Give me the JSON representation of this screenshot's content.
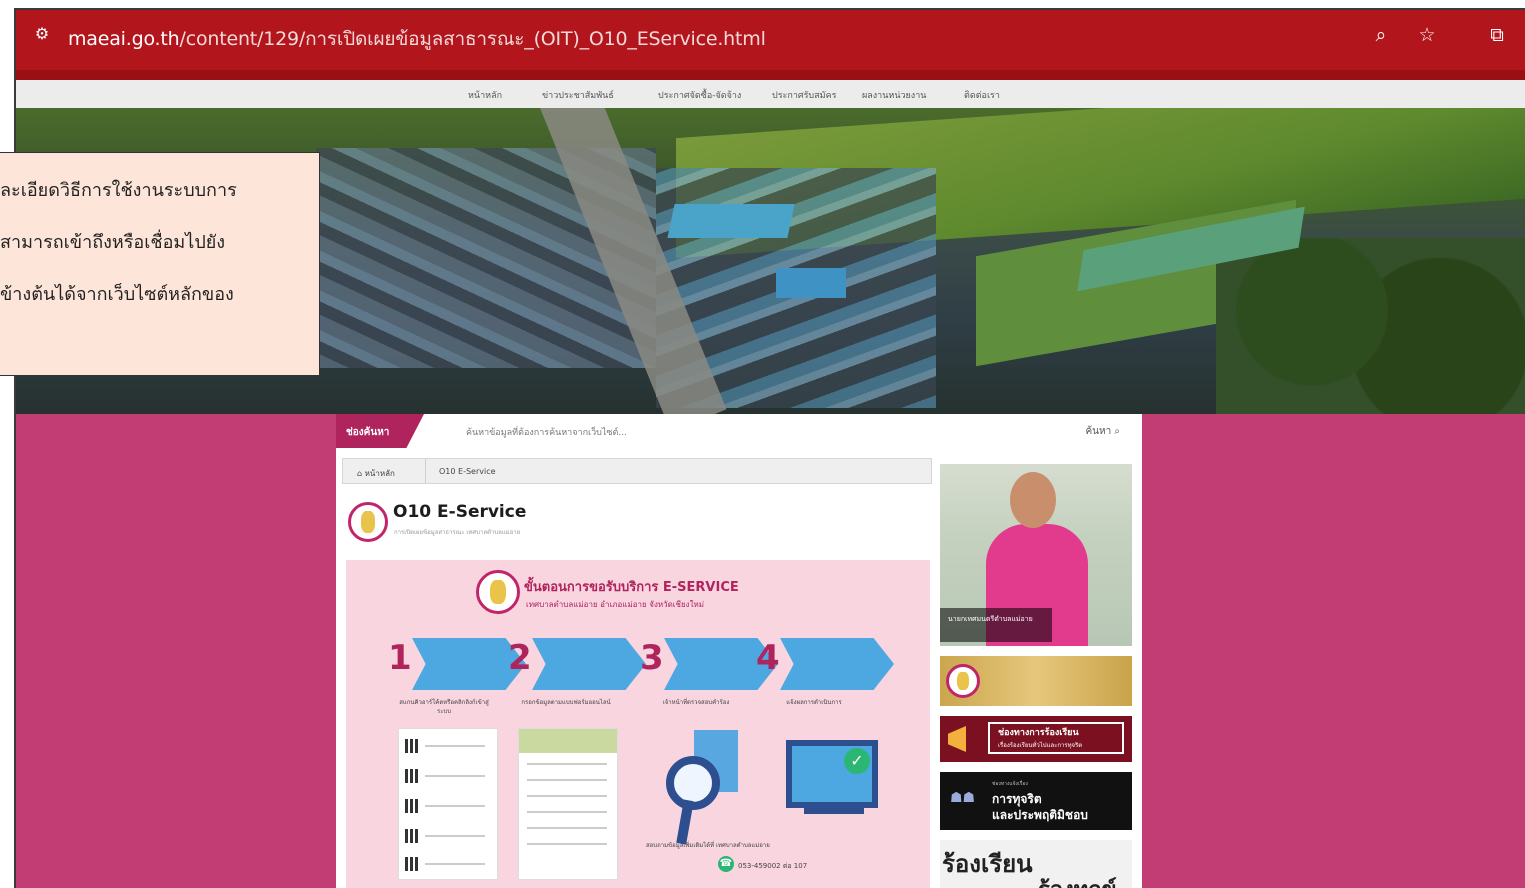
{
  "browser": {
    "url_host": "maeai.go.th",
    "url_path": "/content/129/การเปิดเผยข้อมูลสาธารณะ_(OIT)_O10_EService.html",
    "icons": [
      "site-settings-icon",
      "zoom-icon",
      "star-icon",
      "extensions-icon"
    ]
  },
  "nav": {
    "items": [
      "หน้าหลัก",
      "ข่าวประชาสัมพันธ์",
      "ประกาศจัดซื้อ-จัดจ้าง",
      "ประกาศรับสมัคร",
      "ผลงานหน่วยงาน",
      "ติดต่อเรา"
    ]
  },
  "search": {
    "label": "ช่องค้นหา",
    "placeholder": "ค้นหาข้อมูลที่ต้องการค้นหาจากเว็บไซต์...",
    "button": "ค้นหา"
  },
  "breadcrumb": {
    "home": "หน้าหลัก",
    "current": "O10 E-Service"
  },
  "page": {
    "title": "O10 E-Service",
    "subtitle": "การเปิดเผยข้อมูลสาธารณะ เทศบาลตำบลแม่อาย"
  },
  "poster": {
    "title": "ขั้นตอนการขอรับบริการ E-SERVICE",
    "subtitle": "เทศบาลตำบลแม่อาย อำเภอแม่อาย จังหวัดเชียงใหม่",
    "steps": [
      {
        "num": "1",
        "caption": "สแกนคิวอาร์โค้ดหรือคลิกลิงก์เข้าสู่ระบบ"
      },
      {
        "num": "2",
        "caption": "กรอกข้อมูลตามแบบฟอร์มออนไลน์"
      },
      {
        "num": "3",
        "caption": "เจ้าหน้าที่ตรวจสอบคำร้อง"
      },
      {
        "num": "4",
        "caption": "แจ้งผลการดำเนินการ"
      }
    ],
    "footer": "สอบถามข้อมูลเพิ่มเติมได้ที่ เทศบาลตำบลแม่อาย",
    "phone": "053-459002 ต่อ 107"
  },
  "sidebar": {
    "photo_caption": "นายกเทศมนตรีตำบลแม่อาย",
    "complaint_title": "ช่องทางการร้องเรียน",
    "complaint_sub": "เรื่องร้องเรียนทั่วไปและการทุจริต",
    "corruption_small": "ช่องทางแจ้งเรื่อง",
    "corruption_line1": "การทุจริต",
    "corruption_line2": "และประพฤติมิชอบ",
    "last_line1": "ร้องเรียน",
    "last_line2": "ร้องทุกข์"
  },
  "callout": {
    "lines": [
      "ละเอียดวิธีการใช้งานระบบการ",
      "สามารถเข้าถึงหรือเชื่อมไปยัง",
      "ข้างต้นได้จากเว็บไซต์หลักของ"
    ]
  }
}
